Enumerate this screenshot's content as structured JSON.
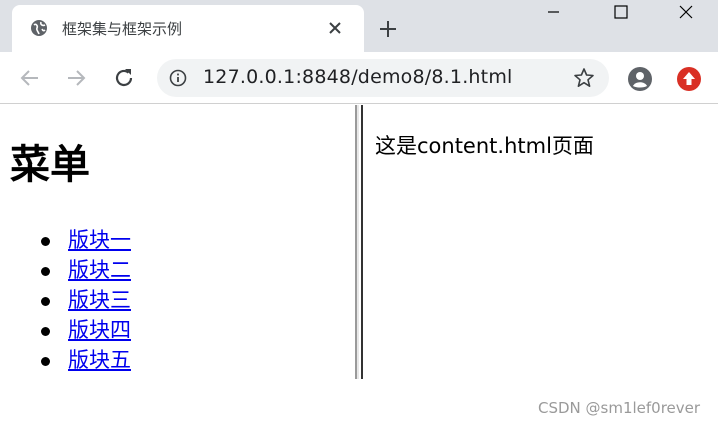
{
  "browser": {
    "tab": {
      "title": "框架集与框架示例",
      "favicon": "globe-icon"
    },
    "window_controls": [
      "minimize-icon",
      "maximize-icon",
      "close-icon"
    ],
    "toolbar": {
      "url": "127.0.0.1:8848/demo8/8.1.html",
      "icons": [
        "back-arrow-icon",
        "forward-arrow-icon",
        "reload-icon",
        "info-icon",
        "star-icon",
        "account-icon",
        "extension-icon"
      ]
    }
  },
  "left_frame": {
    "heading": "菜单",
    "links": [
      "版块一",
      "版块二",
      "版块三",
      "版块四",
      "版块五"
    ]
  },
  "right_frame": {
    "text": "这是content.html页面"
  },
  "watermark": "CSDN @sm1lef0rever",
  "colors": {
    "tabstrip": "#dee1e6",
    "link": "#0000ee",
    "omnibox": "#f1f3f4",
    "extension": "#d93025"
  }
}
